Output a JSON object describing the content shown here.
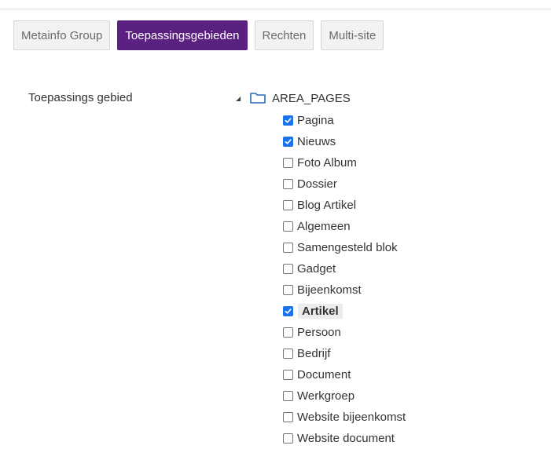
{
  "tabs": [
    {
      "label": "Metainfo Group",
      "active": false
    },
    {
      "label": "Toepassingsgebieden",
      "active": true
    },
    {
      "label": "Rechten",
      "active": false
    },
    {
      "label": "Multi-site",
      "active": false
    }
  ],
  "field_label": "Toepassings gebied",
  "tree": {
    "root": {
      "label": "AREA_PAGES",
      "expanded": true,
      "icon": "folder-icon"
    },
    "items": [
      {
        "label": "Pagina",
        "checked": true
      },
      {
        "label": "Nieuws",
        "checked": true
      },
      {
        "label": "Foto Album",
        "checked": false
      },
      {
        "label": "Dossier",
        "checked": false
      },
      {
        "label": "Blog Artikel",
        "checked": false
      },
      {
        "label": "Algemeen",
        "checked": false
      },
      {
        "label": "Samengesteld blok",
        "checked": false
      },
      {
        "label": "Gadget",
        "checked": false
      },
      {
        "label": "Bijeenkomst",
        "checked": false
      },
      {
        "label": "Artikel",
        "checked": true,
        "highlighted": true
      },
      {
        "label": "Persoon",
        "checked": false
      },
      {
        "label": "Bedrijf",
        "checked": false
      },
      {
        "label": "Document",
        "checked": false
      },
      {
        "label": "Werkgroep",
        "checked": false
      },
      {
        "label": "Website bijeenkomst",
        "checked": false
      },
      {
        "label": "Website document",
        "checked": false
      }
    ]
  },
  "colors": {
    "active_tab": "#5b2180",
    "checkbox_checked": "#1a73e8",
    "folder_icon": "#2a6fb5"
  }
}
